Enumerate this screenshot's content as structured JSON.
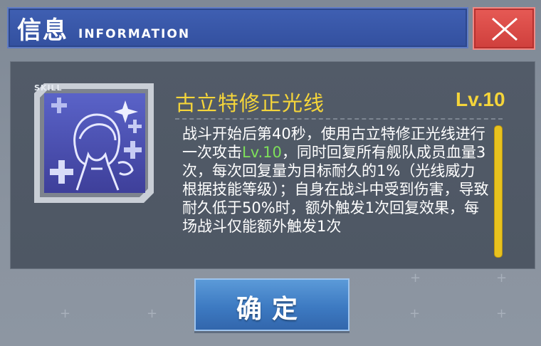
{
  "header": {
    "title": "信息",
    "subtitle": "INFORMATION"
  },
  "close_button": {
    "icon": "close-icon"
  },
  "skill": {
    "tag": "SKILL",
    "name": "古立特修正光线",
    "level": "Lv.10",
    "desc_part1": "战斗开始后第40秒，使用古立特修正光线进行一次攻击",
    "desc_highlight": "Lv.10",
    "desc_part2": "，同时回复所有舰队成员血量3次，每次回复量为目标耐久的1%（光线威力根据技能等级）；自身在战斗中受到伤害，导致耐久低于50%时，额外触发1次回复效果，每场战斗仅能额外触发1次"
  },
  "confirm_button": {
    "label": "确定"
  },
  "colors": {
    "header_blue": "#3f5fb2",
    "close_red": "#e65a55",
    "skill_yellow": "#f5d53a",
    "highlight_green": "#7ee05a",
    "confirm_blue": "#4a86cc"
  }
}
